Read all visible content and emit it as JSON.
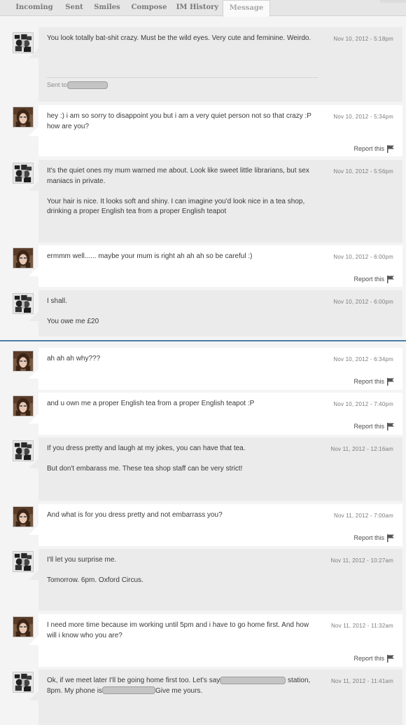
{
  "tabs": [
    {
      "label": "Incoming"
    },
    {
      "label": "Sent"
    },
    {
      "label": "Smiles"
    },
    {
      "label": "Compose"
    },
    {
      "label": "IM History"
    },
    {
      "label": "Message"
    }
  ],
  "report_label": "Report this",
  "sent_to_label": "Sent to",
  "messages": [
    {
      "time": "Nov 10, 2012 - 5:18pm",
      "paragraphs": [
        "You look totally bat-shit crazy. Must be the wild eyes. Very cute and feminine. Weirdo."
      ]
    },
    {
      "time": "Nov 10, 2012 - 5:34pm",
      "paragraphs": [
        "hey :) i am so sorry to disappoint you but i am a very quiet person not so that crazy :P how are you?"
      ]
    },
    {
      "time": "Nov 10, 2012 - 5:56pm",
      "paragraphs": [
        "It's the quiet ones my mum warned me about. Look like sweet little librarians, but sex maniacs in private.",
        "Your hair is nice. It looks soft and shiny. I can imagine you'd look nice in a tea shop, drinking a proper English tea from a proper English teapot"
      ]
    },
    {
      "time": "Nov 10, 2012 - 6:00pm",
      "paragraphs": [
        "ermmm well...... maybe your mum is right ah ah ah so be careful :)"
      ]
    },
    {
      "time": "Nov 10, 2012 - 6:00pm",
      "paragraphs": [
        "I shall.",
        "You owe me £20"
      ]
    },
    {
      "time": "Nov 10, 2012 - 6:34pm",
      "paragraphs": [
        "ah ah ah why???"
      ]
    },
    {
      "time": "Nov 10, 2012 - 7:40pm",
      "paragraphs": [
        "and u own me a proper English tea from a proper English teapot :P"
      ]
    },
    {
      "time": "Nov 11, 2012 - 12:16am",
      "paragraphs": [
        "If you dress pretty and laugh at my jokes, you can have that tea.",
        "But don't embarass me. These tea shop staff can be very strict!"
      ]
    },
    {
      "time": "Nov 11, 2012 - 7:00am",
      "paragraphs": [
        "And what is for you dress pretty and not embarrass you?"
      ]
    },
    {
      "time": "Nov 11, 2012 - 10:27am",
      "paragraphs": [
        "I'll let you surprise me.",
        "Tomorrow. 6pm. Oxford Circus."
      ]
    },
    {
      "time": "Nov 11, 2012 - 11:32am",
      "paragraphs": [
        "I need more time because im working until 5pm and i have to go home first. And how will i know who you are?"
      ]
    },
    {
      "time": "Nov 11, 2012 - 11:41am",
      "text_a": "Ok, if we meet later I'll be going home first too. Let's say",
      "text_b": "station, 8pm. My phone is",
      "text_c": "Give me yours."
    }
  ]
}
